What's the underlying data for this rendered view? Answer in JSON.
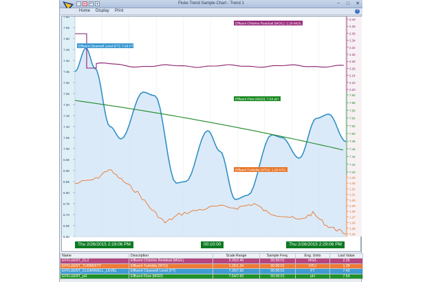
{
  "window": {
    "title": "Fluke Trend Sample Chart - Trend 1",
    "controls": [
      "−",
      "□",
      "✕"
    ]
  },
  "menu": {
    "items": [
      "Home",
      "Display",
      "Print"
    ]
  },
  "chart": {
    "left_axis": {
      "ticks": [
        "7.60",
        "7.55",
        "7.50",
        "7.45",
        "7.40",
        "7.35",
        "7.30",
        "7.25",
        "7.20",
        "7.15",
        "7.10",
        "7.05",
        "7.00",
        "6.95",
        "6.90",
        "6.85",
        "6.80",
        "6.75",
        "6.70",
        "6.65",
        "6.60"
      ]
    },
    "right_axes": [
      {
        "name": "chlorine",
        "color": "#8a1f6e",
        "ticks": [
          "2.40",
          "2.38",
          "2.36",
          "2.34",
          "2.32",
          "2.30",
          "2.28",
          "2.26",
          "2.24",
          "2.22",
          "2.20"
        ]
      },
      {
        "name": "flow",
        "color": "#1c8a24",
        "ticks": [
          "7.60",
          "7.58",
          "7.56",
          "7.54",
          "7.52",
          "7.50",
          "7.48",
          "7.46",
          "7.44",
          "7.42",
          "7.40"
        ]
      },
      {
        "name": "turbidity",
        "color": "#e06a1a",
        "ticks": [
          "1.34",
          "1.33",
          "1.32",
          "1.31",
          "1.30",
          "1.29",
          "1.28",
          "1.27",
          "1.26",
          "1.25",
          "1.24"
        ]
      }
    ],
    "labels": {
      "chlorine": "Effluent Chlorine Residual (MG/L): 2.26 MG/L",
      "clearwell": "Effluent Clearwell Level (FT): 7.43 FT",
      "flow": "Effluent Flow (MGD): 7.54 pH",
      "turbidity": "Effluent Turbidity (NTU): 1.28 NTU"
    },
    "time_start": "Thu 2/26/2015  2:19:06 PM",
    "time_span": "00:10:00",
    "time_end": "Thu 2/26/2015  2:29:06 PM"
  },
  "colors": {
    "chlorine": "#8a1f6e",
    "clearwell": "#2f8fc6",
    "clearwell_fill": "#cfe3f5",
    "flow": "#1c8a24",
    "turbidity": "#e8762a",
    "time_box": "#0c7a22"
  },
  "table": {
    "headers": [
      "Name",
      "Description",
      "Scale Range",
      "Sample Freq.",
      "Eng. Units",
      "Last Value"
    ],
    "rows": [
      {
        "name": "EFFLUENT_CL2",
        "description": "Effluent Chlorine Residual (MG/L)",
        "scale": "2.26/2.40",
        "freq": "00:00:01",
        "units": "MG/L",
        "value": "2.26",
        "bg": "#b5467f",
        "fg": "#ffffff"
      },
      {
        "name": "EFFLUENT_TURBIDITY",
        "description": "Effluent Turbidity (NTU)",
        "scale": "1.26/1.34",
        "freq": "00:00:01",
        "units": "NTU",
        "value": "1.28",
        "bg": "#ef7a36",
        "fg": "#ffffff"
      },
      {
        "name": "EFFLUENT_CLEARWELL_LEVEL",
        "description": "Effluent Clearwell Level (FT)",
        "scale": "7.30/7.60",
        "freq": "00:00:01",
        "units": "FT",
        "value": "7.43",
        "bg": "#3f9bd1",
        "fg": "#ffffff"
      },
      {
        "name": "EFFLUENT_pH",
        "description": "Effluent Flow (MGD)",
        "scale": "7.54/7.60",
        "freq": "00:00:01",
        "units": "pH",
        "value": "7.54",
        "bg": "#20922a",
        "fg": "#ffffff"
      }
    ]
  }
}
